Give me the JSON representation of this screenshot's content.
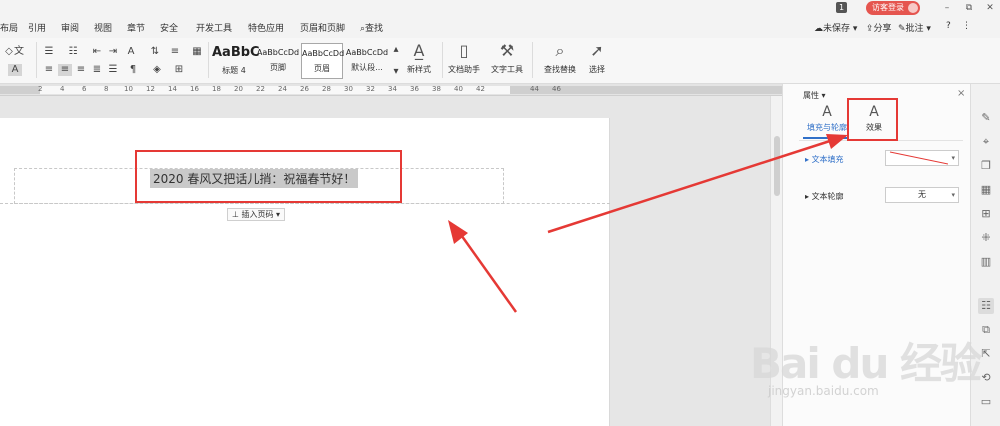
{
  "titlebar": {
    "badge": "1",
    "login": "访客登录",
    "minimize": "–",
    "restore": "⧉",
    "close": "✕"
  },
  "menu": {
    "items": [
      "布局",
      "引用",
      "审阅",
      "视图",
      "章节",
      "安全",
      "开发工具",
      "特色应用",
      "页眉和页脚",
      "查找"
    ],
    "unsaved": "未保存",
    "share": "分享",
    "annotate": "批注",
    "help": "?",
    "more": "⋮"
  },
  "ribbon": {
    "styles": [
      {
        "sample": "AaBbC",
        "name": "标题 4"
      },
      {
        "sample": "AaBbCcDd",
        "name": "页脚"
      },
      {
        "sample": "AaBbCcDd",
        "name": "页眉"
      },
      {
        "sample": "AaBbCcDd",
        "name": "默认段..."
      }
    ],
    "new_style": "新样式",
    "doc_assistant": "文档助手",
    "text_tools": "文字工具",
    "find_replace": "查找替换",
    "select": "选择"
  },
  "ruler": {
    "labels": [
      "2",
      "4",
      "6",
      "8",
      "10",
      "12",
      "14",
      "16",
      "18",
      "20",
      "22",
      "24",
      "26",
      "28",
      "30",
      "32",
      "34",
      "36",
      "38",
      "40",
      "42",
      "44",
      "46"
    ]
  },
  "document": {
    "header_text": "2020 春风又把话儿捎：祝福春节好！",
    "insert_page_number": "插入页码"
  },
  "properties_pane": {
    "title": "属性",
    "close": "×",
    "tabs": [
      {
        "label": "填充与轮廓",
        "icon": "fill-outline-icon"
      },
      {
        "label": "效果",
        "icon": "effect-icon"
      }
    ],
    "text_fill_label": "文本填充",
    "text_outline_label": "文本轮廓",
    "text_outline_value": "无"
  },
  "colors": {
    "accent": "#3070c8",
    "annotation_red": "#e53935",
    "login_badge": "#e5554f"
  },
  "watermark": {
    "logo": "Bai du 经验",
    "url": "jingyan.baidu.com"
  }
}
